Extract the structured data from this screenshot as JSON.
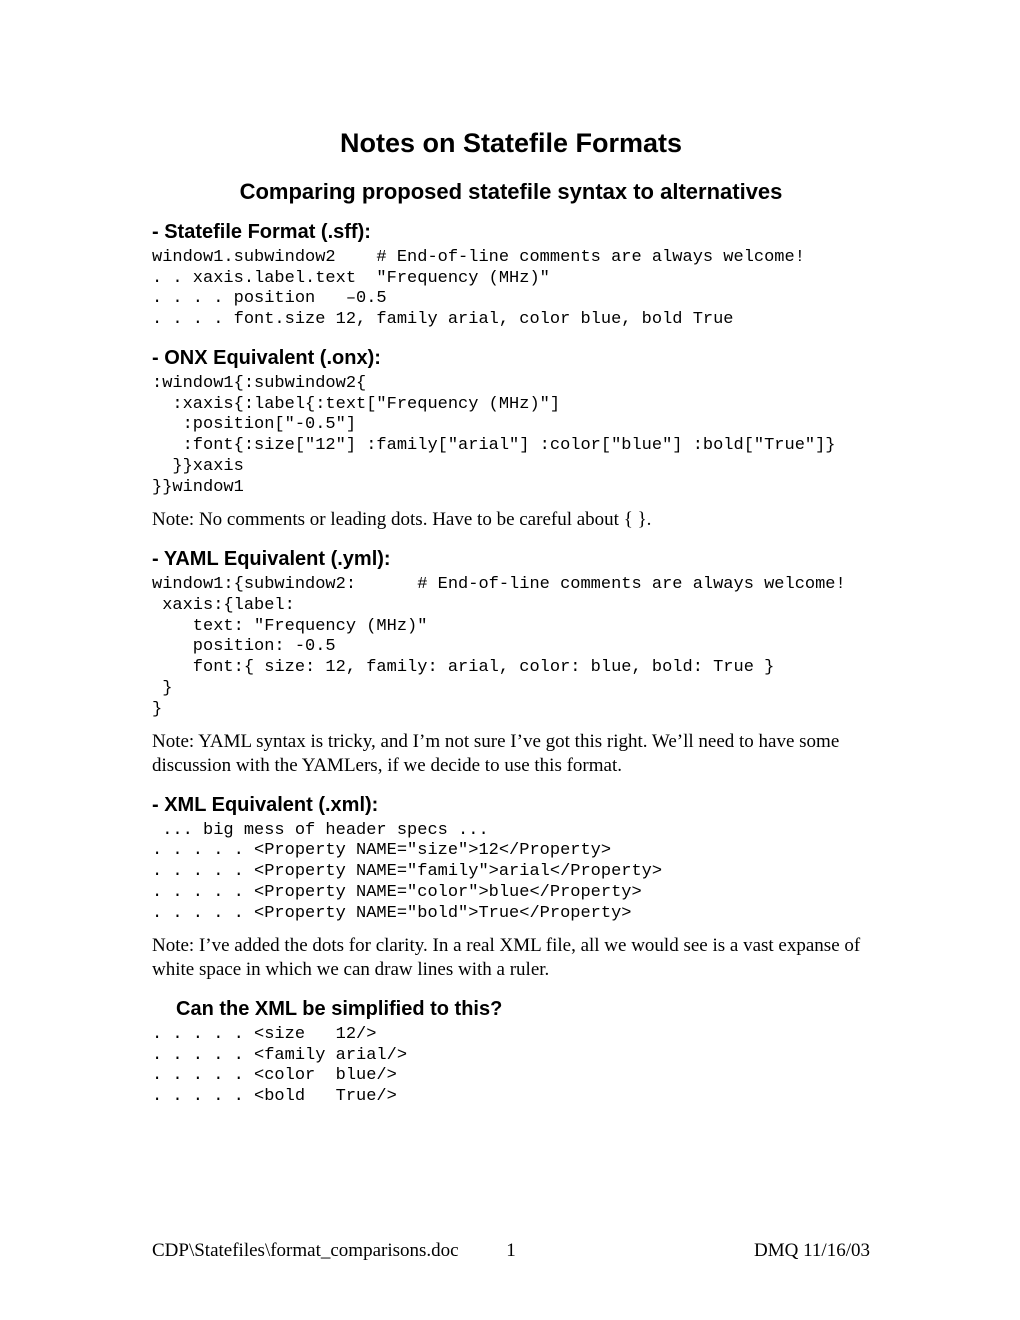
{
  "title": "Notes on Statefile Formats",
  "subtitle": "Comparing proposed statefile syntax to alternatives",
  "sections": {
    "sff": {
      "heading": "- Statefile Format (.sff):",
      "code": "window1.subwindow2    # End-of-line comments are always welcome!\n. . xaxis.label.text  \"Frequency (MHz)\"\n. . . . position   –0.5\n. . . . font.size 12, family arial, color blue, bold True"
    },
    "onx": {
      "heading": "- ONX Equivalent (.onx):",
      "code": ":window1{:subwindow2{\n  :xaxis{:label{:text[\"Frequency (MHz)\"]\n   :position[\"-0.5\"]\n   :font{:size[\"12\"] :family[\"arial\"] :color[\"blue\"] :bold[\"True\"]}\n  }}xaxis\n}}window1",
      "note": "Note:  No comments or leading dots.   Have to be careful about { }."
    },
    "yaml": {
      "heading": "- YAML Equivalent (.yml):",
      "code": "window1:{subwindow2:      # End-of-line comments are always welcome!\n xaxis:{label:\n    text: \"Frequency (MHz)\"\n    position: -0.5\n    font:{ size: 12, family: arial, color: blue, bold: True }\n }\n}",
      "note": "Note:  YAML syntax is tricky, and I’m not sure I’ve got this right.  We’ll need to have some discussion with the YAMLers, if we decide to use this format."
    },
    "xml": {
      "heading": "- XML Equivalent (.xml):",
      "code": " ... big mess of header specs ...\n. . . . . <Property NAME=\"size\">12</Property>\n. . . . . <Property NAME=\"family\">arial</Property>\n. . . . . <Property NAME=\"color\">blue</Property>\n. . . . . <Property NAME=\"bold\">True</Property>",
      "note": "Note:  I’ve added the dots for clarity.  In a real XML file, all we would see is a vast expanse of white space in which we can draw lines with a ruler."
    },
    "xml2": {
      "heading": "Can the XML be simplified to this?",
      "code": ". . . . . <size   12/>\n. . . . . <family arial/>\n. . . . . <color  blue/>\n. . . . . <bold   True/>"
    }
  },
  "footer": {
    "left": "CDP\\Statefiles\\format_comparisons.doc",
    "center": "1",
    "right": "DMQ 11/16/03"
  }
}
